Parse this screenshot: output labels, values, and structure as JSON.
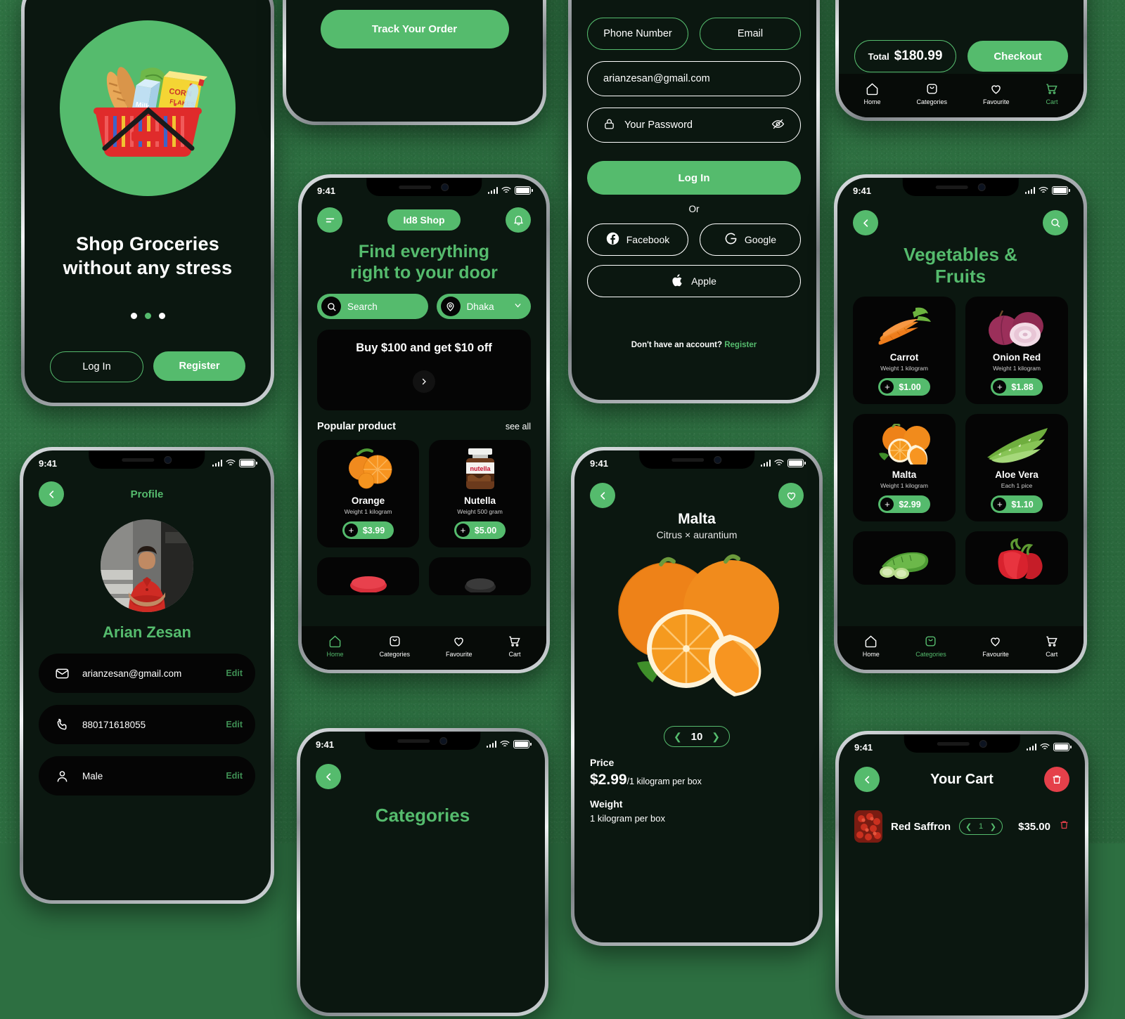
{
  "status_bar": {
    "time": "9:41"
  },
  "accent": "#55bb6d",
  "danger": "#e5404a",
  "onboarding": {
    "title_line1": "Shop Groceries",
    "title_line2": "without any stress",
    "login_label": "Log In",
    "register_label": "Register",
    "dots_total": 3,
    "dot_active_index": 1
  },
  "track": {
    "button_label": "Track Your Order"
  },
  "login": {
    "tab_phone": "Phone Number",
    "tab_email": "Email",
    "email_value": "arianzesan@gmail.com",
    "password_placeholder": "Your Password",
    "login_button": "Log In",
    "or_label": "Or",
    "facebook_label": "Facebook",
    "google_label": "Google",
    "apple_label": "Apple",
    "no_account_text": "Don't have an account?",
    "register_link": "Register"
  },
  "checkout_bar": {
    "total_label": "Total",
    "total_amount": "$180.99",
    "checkout_label": "Checkout"
  },
  "profile": {
    "header_title": "Profile",
    "name": "Arian Zesan",
    "rows": [
      {
        "icon": "mail-icon",
        "value": "arianzesan@gmail.com",
        "action": "Edit"
      },
      {
        "icon": "phone-icon",
        "value": "880171618055",
        "action": "Edit"
      },
      {
        "icon": "user-icon",
        "value": "Male",
        "action": "Edit"
      }
    ]
  },
  "home": {
    "brand": "Id8 Shop",
    "hero_line1": "Find everything",
    "hero_line2": "right to your door",
    "search_placeholder": "Search",
    "location": "Dhaka",
    "banner_text": "Buy $100 and get $10 off",
    "section_title": "Popular product",
    "see_all": "see all",
    "products": [
      {
        "name": "Orange",
        "weight": "Weight 1 kilogram",
        "price": "$3.99",
        "img": "orange"
      },
      {
        "name": "Nutella",
        "weight": "Weight 500 gram",
        "price": "$5.00",
        "img": "nutella"
      }
    ]
  },
  "categories_screen": {
    "title": "Categories"
  },
  "product_detail": {
    "title": "Malta",
    "subtitle": "Citrus × aurantium",
    "quantity": "10",
    "price_label": "Price",
    "price_value": "$2.99",
    "price_unit": "/1 kilogram per box",
    "weight_label": "Weight",
    "weight_value": "1 kilogram per box"
  },
  "vegetables_fruits": {
    "title_line1": "Vegetables &",
    "title_line2": "Fruits",
    "products": [
      {
        "name": "Carrot",
        "weight": "Weight 1 kilogram",
        "price": "$1.00",
        "img": "carrot"
      },
      {
        "name": "Onion Red",
        "weight": "Weight 1 kilogram",
        "price": "$1.88",
        "img": "onion"
      },
      {
        "name": "Malta",
        "weight": "Weight 1 kilogram",
        "price": "$2.99",
        "img": "malta"
      },
      {
        "name": "Aloe Vera",
        "weight": "Each 1 pice",
        "price": "$1.10",
        "img": "aloe"
      }
    ]
  },
  "cart": {
    "title": "Your Cart",
    "item_name": "Red Saffron",
    "item_qty": "1",
    "item_price": "$35.00"
  },
  "bottom_nav": {
    "home": "Home",
    "categories": "Categories",
    "favourite": "Favourite",
    "cart": "Cart"
  }
}
